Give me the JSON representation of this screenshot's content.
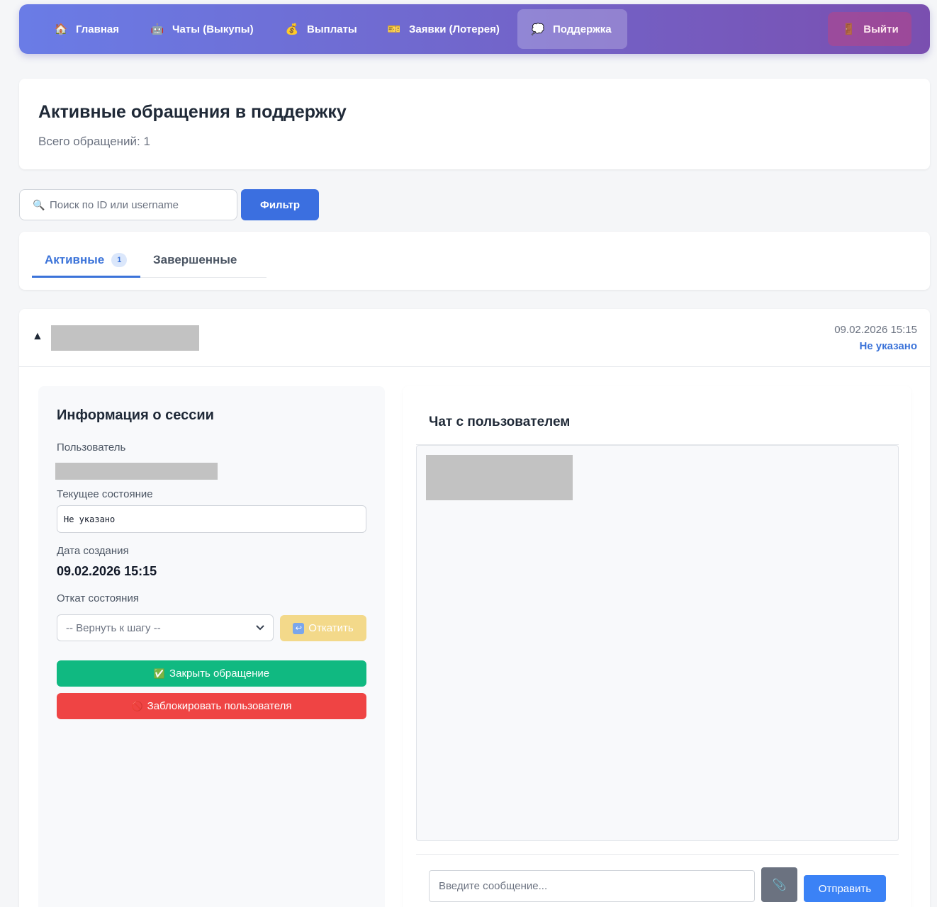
{
  "nav": {
    "items": [
      {
        "label": "Главная",
        "icon": "🏠",
        "icon_name": "house-icon"
      },
      {
        "label": "Чаты (Выкупы)",
        "icon": "🤖",
        "icon_name": "robot-icon"
      },
      {
        "label": "Выплаты",
        "icon": "💰",
        "icon_name": "money-bag-icon"
      },
      {
        "label": "Заявки (Лотерея)",
        "icon": "🎫",
        "icon_name": "ticket-icon"
      },
      {
        "label": "Поддержка",
        "icon": "💭",
        "icon_name": "thought-bubble-icon",
        "active": true
      }
    ],
    "logout": {
      "label": "Выйти",
      "icon": "🚪",
      "icon_name": "door-icon"
    }
  },
  "header": {
    "title": "Активные обращения в поддержку",
    "subtitle": "Всего обращений: 1"
  },
  "search": {
    "icon": "🔍",
    "placeholder": "Поиск по ID или username",
    "filter_label": "Фильтр"
  },
  "tabs": {
    "active": {
      "label": "Активные",
      "count": "1"
    },
    "completed": {
      "label": "Завершенные"
    }
  },
  "ticket": {
    "toggle": "▲",
    "date": "09.02.2026 15:15",
    "status": "Не указано",
    "session": {
      "title": "Информация о сессии",
      "user_label": "Пользователь",
      "state_label": "Текущее состояние",
      "state_value": "Не указано",
      "created_label": "Дата создания",
      "created_value": "09.02.2026 15:15",
      "rollback_label": "Откат состояния",
      "rollback_placeholder": "-- Вернуть к шагу --",
      "rollback_button": "Откатить",
      "rollback_icon": "↩",
      "close_button": "Закрыть обращение",
      "close_icon": "✅",
      "block_button": "Заблокировать пользователя",
      "block_icon": "🚫"
    },
    "chat": {
      "title": "Чат с пользователем",
      "input_placeholder": "Введите сообщение...",
      "attach_icon": "📎",
      "send_label": "Отправить"
    }
  },
  "colors": {
    "nav_gradient_start": "#6a7ce6",
    "nav_gradient_end": "#7a4fb0",
    "accent": "#3b73d9",
    "success": "#10b981",
    "danger": "#ef4444",
    "warning": "#f3d98a"
  }
}
